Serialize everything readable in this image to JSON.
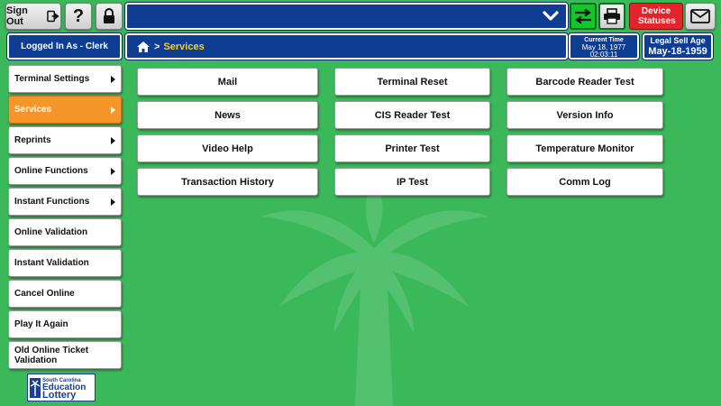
{
  "header": {
    "signout_label": "Sign Out",
    "help_label": "?",
    "device_statuses_label": "Device Statuses",
    "logged_in_label": "Logged In As - Clerk",
    "breadcrumb": {
      "separator": ">",
      "current": "Services"
    },
    "current_time": {
      "label": "Current Time",
      "date": "May 18, 1977",
      "time": "02:03:11"
    },
    "legal_age": {
      "label": "Legal Sell Age",
      "value": "May-18-1959"
    }
  },
  "sidebar": {
    "items": [
      {
        "label": "Terminal Settings",
        "has_arrow": true,
        "active": false
      },
      {
        "label": "Services",
        "has_arrow": true,
        "active": true
      },
      {
        "label": "Reprints",
        "has_arrow": true,
        "active": false
      },
      {
        "label": "Online Functions",
        "has_arrow": true,
        "active": false
      },
      {
        "label": "Instant Functions",
        "has_arrow": true,
        "active": false
      },
      {
        "label": "Online Validation",
        "has_arrow": false,
        "active": false
      },
      {
        "label": "Instant Validation",
        "has_arrow": false,
        "active": false
      },
      {
        "label": "Cancel Online",
        "has_arrow": false,
        "active": false
      },
      {
        "label": "Play It Again",
        "has_arrow": false,
        "active": false
      },
      {
        "label": "Old Online Ticket Validation",
        "has_arrow": false,
        "active": false
      }
    ]
  },
  "services": {
    "buttons": [
      [
        "Mail",
        "Terminal Reset",
        "Barcode Reader Test"
      ],
      [
        "News",
        "CIS Reader Test",
        "Version Info"
      ],
      [
        "Video Help",
        "Printer Test",
        "Temperature Monitor"
      ],
      [
        "Transaction History",
        "IP Test",
        "Comm Log"
      ]
    ]
  },
  "logo": {
    "line1": "South Carolina",
    "line2": "Education",
    "line3": "Lottery"
  },
  "icons": {
    "signout": "sign-out-arrow-icon",
    "lock": "lock-icon",
    "dropdown": "chevron-down-icon",
    "swap": "swap-arrows-icon",
    "printer": "printer-icon",
    "mail": "envelope-icon",
    "home": "home-icon",
    "background": "palmetto-tree-watermark"
  },
  "colors": {
    "background": "#3bb85a",
    "navy": "#0f3d91",
    "active_tab": "#f5962a",
    "device_status": "#e3242b",
    "green_button": "#12c62c",
    "breadcrumb_text": "#f7d21c"
  }
}
